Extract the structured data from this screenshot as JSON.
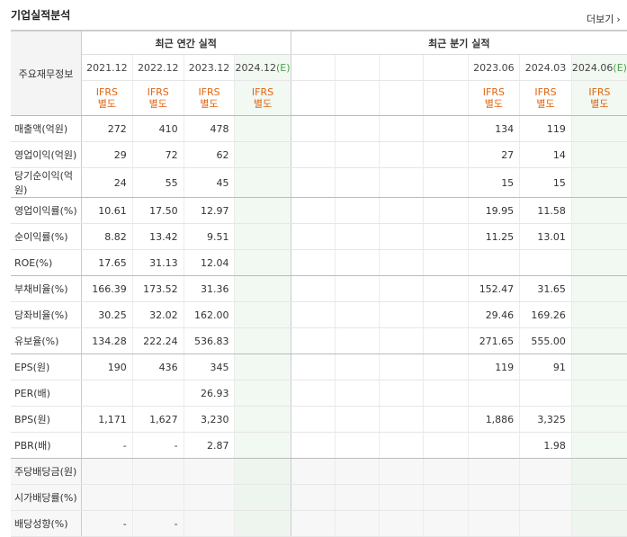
{
  "header": {
    "title": "기업실적분석",
    "more_label": "더보기",
    "more_chevron": "›"
  },
  "table": {
    "label_header": "주요재무정보",
    "annual_header": "최근 연간 실적",
    "quarter_header": "최근 분기 실적",
    "annual_dates": [
      "2021.12",
      "2022.12",
      "2023.12",
      "2024.12"
    ],
    "quarter_dates": [
      "2023.06",
      "2024.03",
      "2024.06"
    ],
    "estimate_mark": "(E)",
    "ifrs_line1": "IFRS",
    "ifrs_line2": "별도",
    "rows": [
      {
        "label": "매출액(억원)",
        "a": [
          "272",
          "410",
          "478",
          ""
        ],
        "q": [
          "134",
          "119",
          ""
        ]
      },
      {
        "label": "영업이익(억원)",
        "a": [
          "29",
          "72",
          "62",
          ""
        ],
        "q": [
          "27",
          "14",
          ""
        ]
      },
      {
        "label": "당기순이익(억원)",
        "a": [
          "24",
          "55",
          "45",
          ""
        ],
        "q": [
          "15",
          "15",
          ""
        ]
      },
      {
        "label": "영업이익률(%)",
        "a": [
          "10.61",
          "17.50",
          "12.97",
          ""
        ],
        "q": [
          "19.95",
          "11.58",
          ""
        ]
      },
      {
        "label": "순이익률(%)",
        "a": [
          "8.82",
          "13.42",
          "9.51",
          ""
        ],
        "q": [
          "11.25",
          "13.01",
          ""
        ]
      },
      {
        "label": "ROE(%)",
        "a": [
          "17.65",
          "31.13",
          "12.04",
          ""
        ],
        "q": [
          "",
          "",
          ""
        ]
      },
      {
        "label": "부채비율(%)",
        "a": [
          "166.39",
          "173.52",
          "31.36",
          ""
        ],
        "q": [
          "152.47",
          "31.65",
          ""
        ]
      },
      {
        "label": "당좌비율(%)",
        "a": [
          "30.25",
          "32.02",
          "162.00",
          ""
        ],
        "q": [
          "29.46",
          "169.26",
          ""
        ]
      },
      {
        "label": "유보율(%)",
        "a": [
          "134.28",
          "222.24",
          "536.83",
          ""
        ],
        "q": [
          "271.65",
          "555.00",
          ""
        ]
      },
      {
        "label": "EPS(원)",
        "a": [
          "190",
          "436",
          "345",
          ""
        ],
        "q": [
          "119",
          "91",
          ""
        ]
      },
      {
        "label": "PER(배)",
        "a": [
          "",
          "",
          "26.93",
          ""
        ],
        "q": [
          "",
          "",
          ""
        ]
      },
      {
        "label": "BPS(원)",
        "a": [
          "1,171",
          "1,627",
          "3,230",
          ""
        ],
        "q": [
          "1,886",
          "3,325",
          ""
        ]
      },
      {
        "label": "PBR(배)",
        "a": [
          "-",
          "-",
          "2.87",
          ""
        ],
        "q": [
          "",
          "1.98",
          ""
        ]
      },
      {
        "label": "주당배당금(원)",
        "a": [
          "",
          "",
          "",
          ""
        ],
        "q": [
          "",
          "",
          ""
        ]
      },
      {
        "label": "시가배당률(%)",
        "a": [
          "",
          "",
          "",
          ""
        ],
        "q": [
          "",
          "",
          ""
        ]
      },
      {
        "label": "배당성향(%)",
        "a": [
          "-",
          "-",
          "",
          ""
        ],
        "q": [
          "",
          "",
          ""
        ]
      }
    ]
  }
}
